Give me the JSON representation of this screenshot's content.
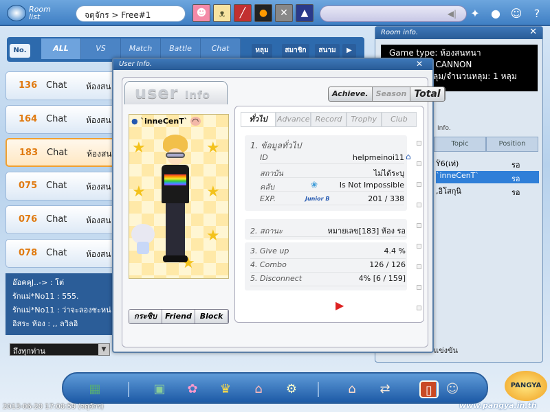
{
  "top": {
    "room_list_label": "Room list",
    "breadcrumb": "จตุจักร > Free#1"
  },
  "room_list": {
    "no_label": "No.",
    "tabs": [
      "ALL",
      "VS",
      "Match",
      "Battle",
      "Chat"
    ],
    "sort_buttons": [
      "หลุม",
      "สมาชิก",
      "สนาม"
    ],
    "rooms": [
      {
        "num": "136",
        "type": "Chat",
        "name": "ห้องสน"
      },
      {
        "num": "164",
        "type": "Chat",
        "name": "ห้องสน"
      },
      {
        "num": "183",
        "type": "Chat",
        "name": "ห้องสน"
      },
      {
        "num": "075",
        "type": "Chat",
        "name": "ห้องสน"
      },
      {
        "num": "076",
        "type": "Chat",
        "name": "ห้องสน"
      },
      {
        "num": "078",
        "type": "Chat",
        "name": "ห้องสน"
      }
    ],
    "chat_lines": [
      "อ๊อคคุJ..-> : โต่",
      "รักแม่*No11 : 555.",
      "รักแม่*No11 : ว่าจะลองชะหน่",
      "อิสระ ห้อง : ,, ลวิลอิ"
    ],
    "chat_target": "ถึงทุกท่าน"
  },
  "room_info": {
    "title": "Room info.",
    "lines": [
      "Game type: ห้องสนทนา",
      "E CANNON",
      "หลุม/จำนวนหลุม: 1 หลุม"
    ],
    "info_label": "Info.",
    "col_topic": "Topic",
    "col_position": "Position",
    "players": [
      {
        "name": "Ÿ6(เท่)",
        "status": "รอ"
      },
      {
        "name": "`inneCenT`",
        "status": "รอ"
      },
      {
        "name": ",อิโสกุนิ",
        "status": "รอ"
      }
    ],
    "bottom_text": "แข่งขัน"
  },
  "user_info": {
    "title": "User Info.",
    "user_tab": "user",
    "user_tab_small": "Info",
    "stat_tabs": [
      "Achieve.",
      "Season",
      "Total"
    ],
    "player_name": "`inneCenT`",
    "actions": [
      "กระซิบ",
      "Friend",
      "Block"
    ],
    "sub_tabs": [
      "ทั่วไป",
      "Advance",
      "Record",
      "Trophy",
      "Club"
    ],
    "section1": "1. ข้อมูลทั่วไป",
    "general": [
      {
        "key": "ID",
        "value": "helpmeinoi11"
      },
      {
        "key": "สถาบัน",
        "value": "ไม่ได้ระบุ"
      },
      {
        "key": "คลับ",
        "value": "Is Not Impossible"
      },
      {
        "key": "EXP.",
        "value": "201 / 338",
        "rank": "Junior B"
      }
    ],
    "status_key": "2. สถานะ",
    "status_value": "หมายเลข[183] ห้อง รอ",
    "stats": [
      {
        "key": "3. Give up",
        "value": "4.4 %"
      },
      {
        "key": "4. Combo",
        "value": "126 / 126"
      },
      {
        "key": "5. Disconnect",
        "value": "4% [6 / 159]"
      }
    ]
  },
  "footer": {
    "timestamp": "2013-06-20 17:00:59 (จตุจักร)",
    "site": "www.pangya.in.th",
    "logo": "PANGYA"
  }
}
